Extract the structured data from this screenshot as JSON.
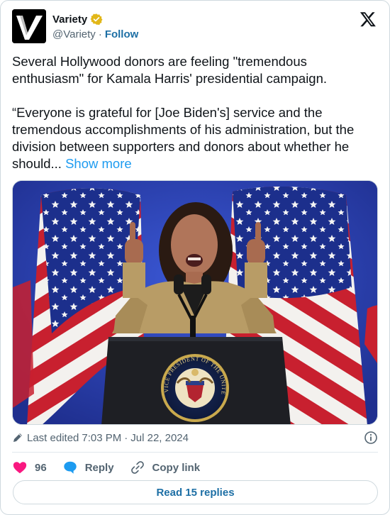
{
  "author": {
    "display_name": "Variety",
    "handle": "@Variety",
    "separator": "·",
    "follow_label": "Follow",
    "avatar_letter": "V"
  },
  "tweet": {
    "paragraph_1": "Several Hollywood donors are feeling \"tremendous enthusiasm\" for Kamala Harris' presidential campaign.",
    "paragraph_2": "“Everyone is grateful for [Joe Biden's] service and the tremendous accomplishments of his administration, but the division between supporters and donors about whether he should...",
    "show_more_label": "Show more"
  },
  "meta": {
    "edited_label": "Last edited",
    "time": "7:03 PM",
    "separator": "·",
    "date": "Jul 22, 2024"
  },
  "media": {
    "seal_text": "VICE PRESIDENT OF THE UNITED STATES"
  },
  "actions": {
    "like_count": "96",
    "reply_label": "Reply",
    "copy_link_label": "Copy link"
  },
  "footer": {
    "read_replies_label": "Read 15 replies"
  },
  "colors": {
    "link_blue": "#1d9bf0",
    "follow_blue": "#1d6fa5",
    "heart_pink": "#f91880",
    "verified_gold": "#e2b719"
  }
}
